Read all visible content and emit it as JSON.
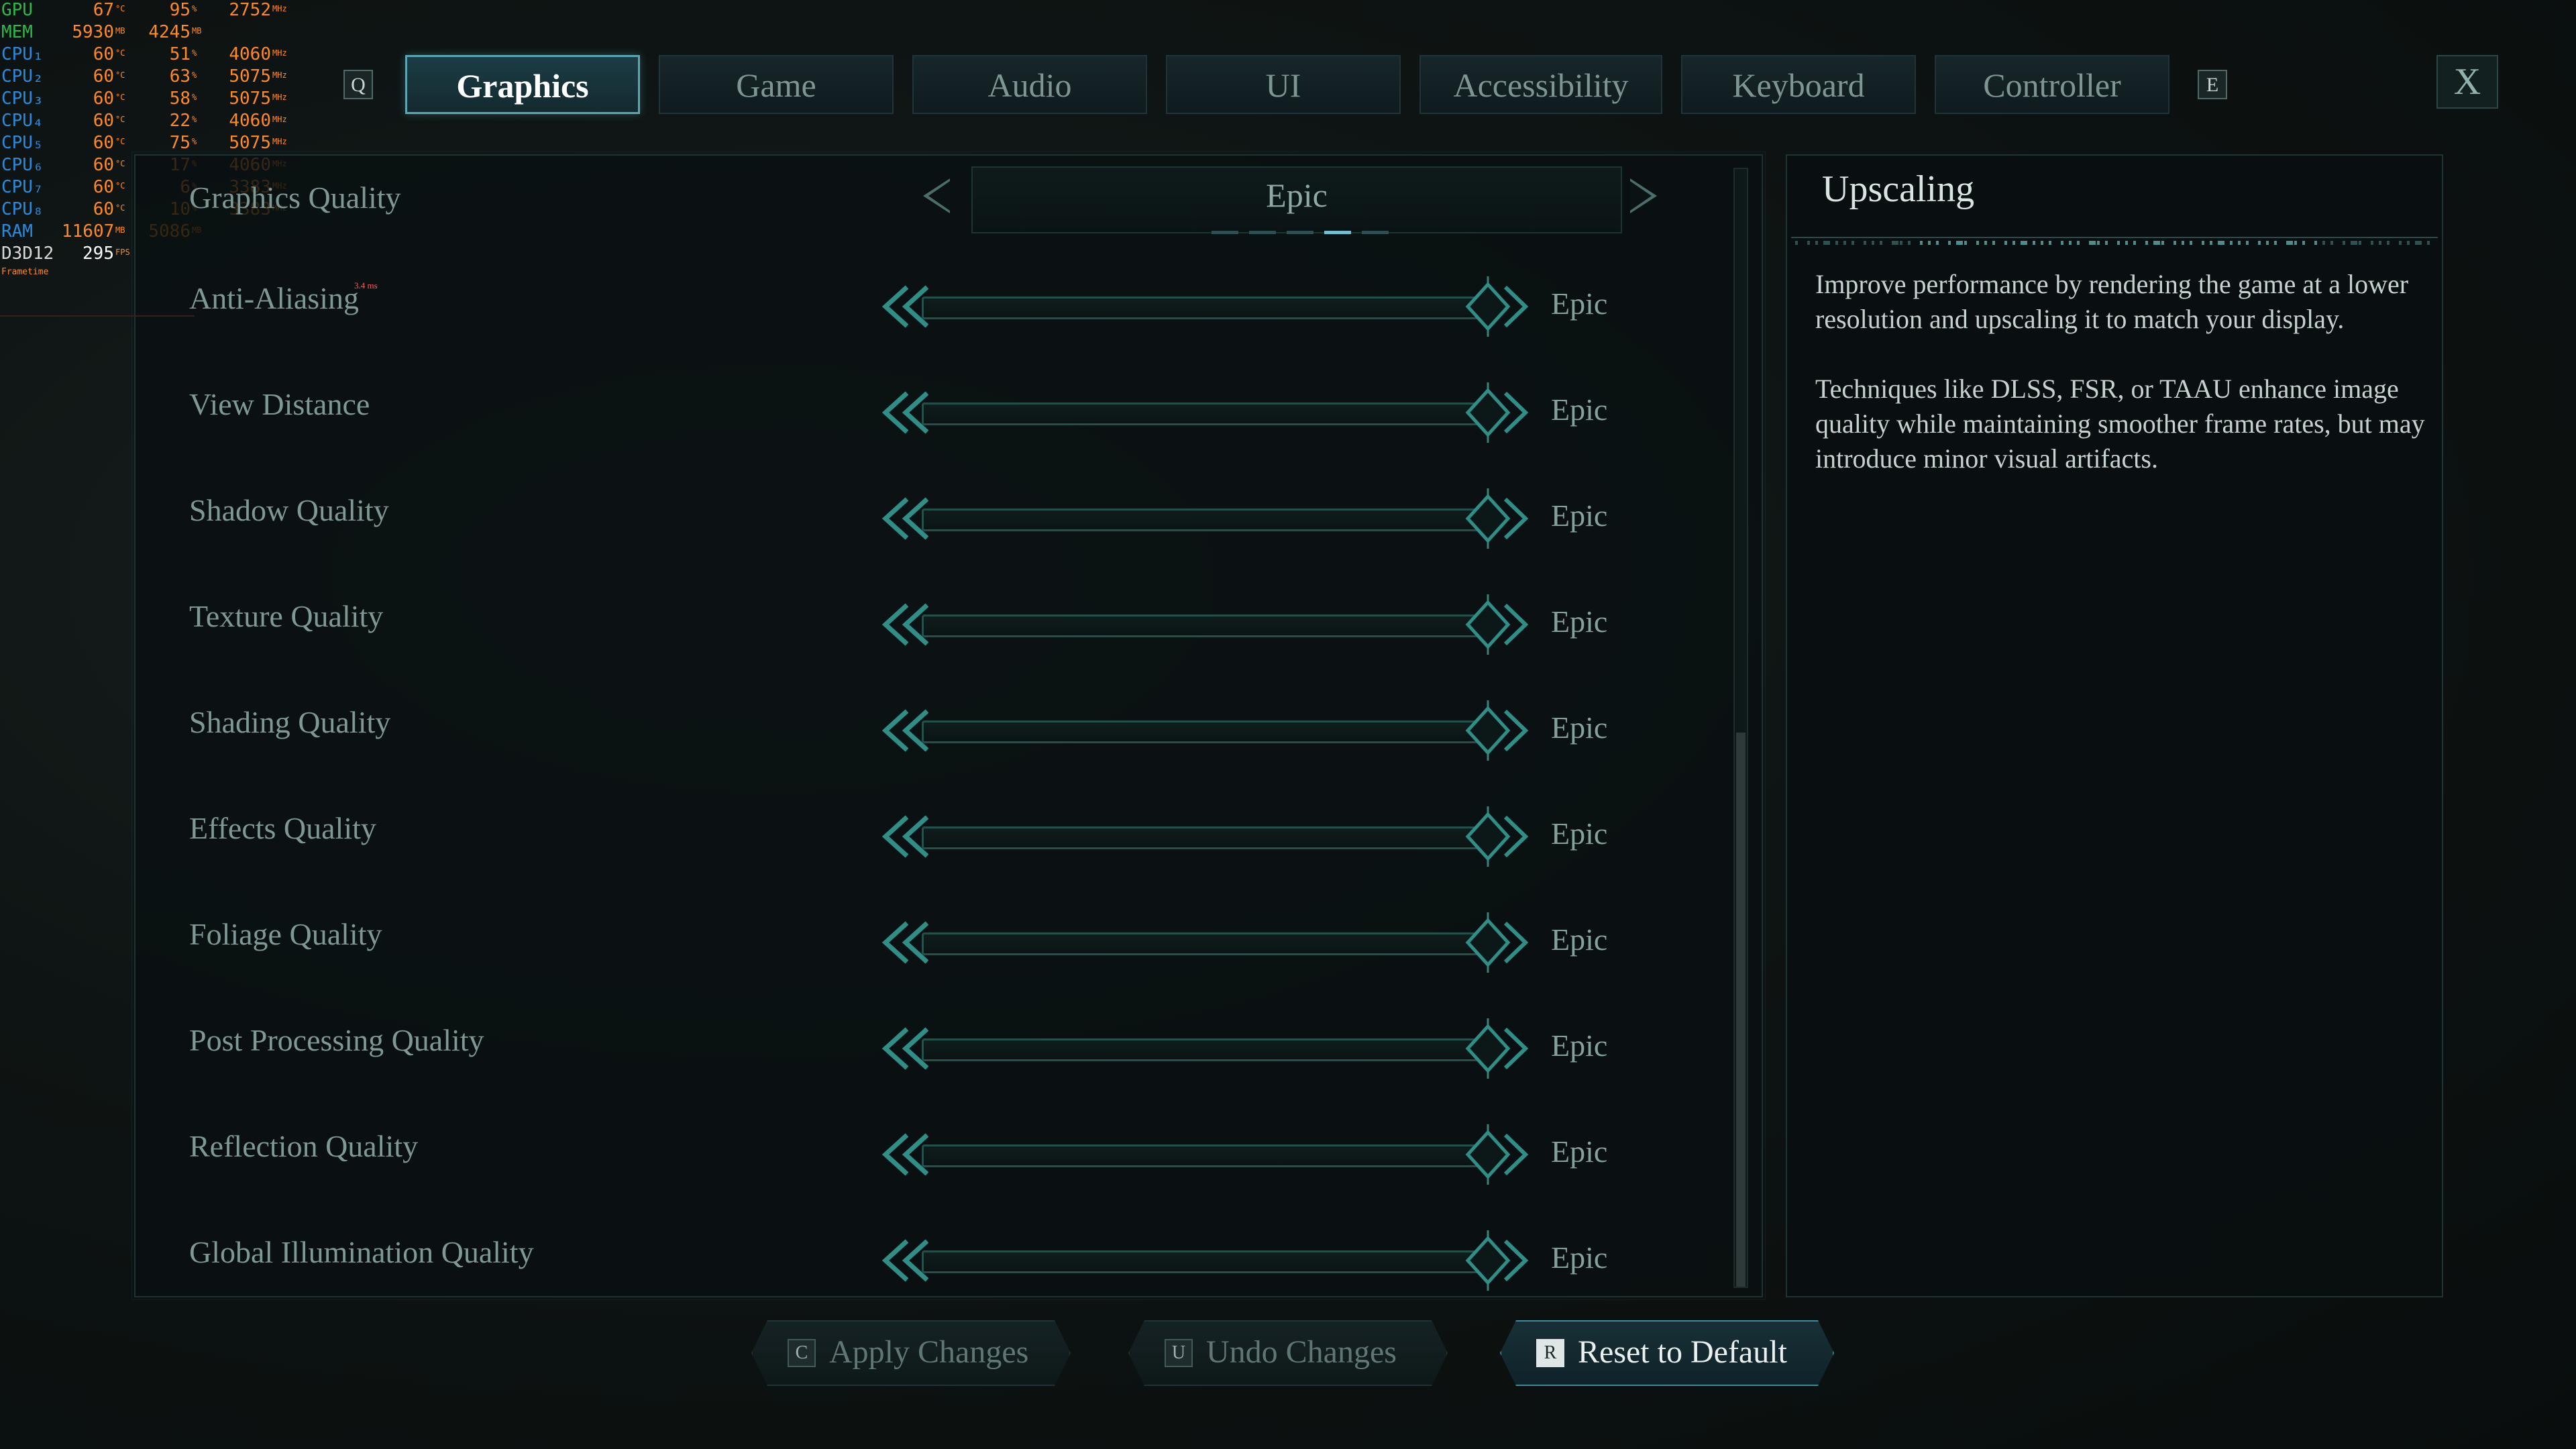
{
  "hw_monitor": {
    "rows": [
      {
        "name": "GPU",
        "name_color": "#2fb64c",
        "v1": "67",
        "u1": "°C",
        "v2": "95",
        "u2": "%",
        "v3": "2752",
        "u3": "MHz"
      },
      {
        "name": "MEM",
        "name_color": "#2fb64c",
        "v1": "5930",
        "u1": "MB",
        "v2": "4245",
        "u2": "MB",
        "v3": "",
        "u3": ""
      },
      {
        "name": "CPU₁",
        "name_color": "#2b8bdb",
        "v1": "60",
        "u1": "°C",
        "v2": "51",
        "u2": "%",
        "v3": "4060",
        "u3": "MHz"
      },
      {
        "name": "CPU₂",
        "name_color": "#2b8bdb",
        "v1": "60",
        "u1": "°C",
        "v2": "63",
        "u2": "%",
        "v3": "5075",
        "u3": "MHz"
      },
      {
        "name": "CPU₃",
        "name_color": "#2b8bdb",
        "v1": "60",
        "u1": "°C",
        "v2": "58",
        "u2": "%",
        "v3": "5075",
        "u3": "MHz"
      },
      {
        "name": "CPU₄",
        "name_color": "#2b8bdb",
        "v1": "60",
        "u1": "°C",
        "v2": "22",
        "u2": "%",
        "v3": "4060",
        "u3": "MHz"
      },
      {
        "name": "CPU₅",
        "name_color": "#2b8bdb",
        "v1": "60",
        "u1": "°C",
        "v2": "75",
        "u2": "%",
        "v3": "5075",
        "u3": "MHz"
      },
      {
        "name": "CPU₆",
        "name_color": "#2b8bdb",
        "v1": "60",
        "u1": "°C",
        "v2": "17",
        "u2": "%",
        "v3": "4060",
        "u3": "MHz"
      },
      {
        "name": "CPU₇",
        "name_color": "#2b8bdb",
        "v1": "60",
        "u1": "°C",
        "v2": "6",
        "u2": "%",
        "v3": "3383",
        "u3": "MHz"
      },
      {
        "name": "CPU₈",
        "name_color": "#2b8bdb",
        "v1": "60",
        "u1": "°C",
        "v2": "10",
        "u2": "%",
        "v3": "3383",
        "u3": "MHz"
      },
      {
        "name": "RAM",
        "name_color": "#2b8bdb",
        "v1": "11607",
        "u1": "MB",
        "v2": "5086",
        "u2": "MB",
        "v3": "",
        "u3": ""
      },
      {
        "name": "D3D12",
        "name_color": "#d9d9d9",
        "v1": "295",
        "u1": "FPS",
        "v2": "",
        "u2": "",
        "v3": "",
        "u3": ""
      }
    ],
    "frametime_label": "Frametime",
    "frametime_value": "3.4 ms"
  },
  "tabs": {
    "left_key": "Q",
    "right_key": "E",
    "items": [
      {
        "label": "Graphics",
        "active": true
      },
      {
        "label": "Game",
        "active": false
      },
      {
        "label": "Audio",
        "active": false
      },
      {
        "label": "UI",
        "active": false
      },
      {
        "label": "Accessibility",
        "active": false
      },
      {
        "label": "Keyboard",
        "active": false
      },
      {
        "label": "Controller",
        "active": false
      }
    ],
    "close_label": "X"
  },
  "settings": {
    "graphics_quality": {
      "label": "Graphics Quality",
      "value": "Epic",
      "level": 4,
      "levels": 5
    },
    "rows": [
      {
        "label": "Anti-Aliasing",
        "value": "Epic"
      },
      {
        "label": "View Distance",
        "value": "Epic"
      },
      {
        "label": "Shadow Quality",
        "value": "Epic"
      },
      {
        "label": "Texture Quality",
        "value": "Epic"
      },
      {
        "label": "Shading Quality",
        "value": "Epic"
      },
      {
        "label": "Effects Quality",
        "value": "Epic"
      },
      {
        "label": "Foliage Quality",
        "value": "Epic"
      },
      {
        "label": "Post Processing Quality",
        "value": "Epic"
      },
      {
        "label": "Reflection Quality",
        "value": "Epic"
      },
      {
        "label": "Global Illumination Quality",
        "value": "Epic"
      }
    ]
  },
  "info": {
    "title": "Upscaling",
    "paragraphs": [
      "Improve performance by rendering the game at a lower resolution and upscaling it to match your display.",
      "Techniques like DLSS, FSR, or TAAU enhance image quality while maintaining smoother frame rates, but may introduce minor visual artifacts."
    ]
  },
  "footer": {
    "apply": {
      "key": "C",
      "label": "Apply Changes"
    },
    "undo": {
      "key": "U",
      "label": "Undo Changes"
    },
    "reset": {
      "key": "R",
      "label": "Reset to Default"
    }
  },
  "colors": {
    "accent": "#5aa6b3",
    "slider_teal": "#2f8f86",
    "hw_value": "#ff8a24"
  }
}
